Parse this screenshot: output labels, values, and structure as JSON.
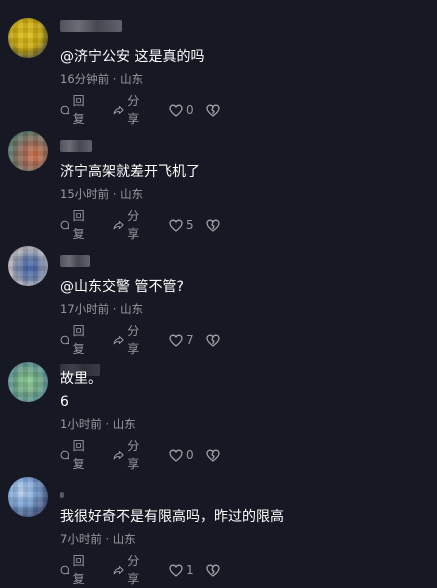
{
  "actions": {
    "reply_label": "回复",
    "share_label": "分享"
  },
  "comments": [
    {
      "text": "@济宁公安 这是真的吗",
      "extra": "",
      "time": "16分钟前",
      "location": "山东",
      "likes": "0"
    },
    {
      "text": "济宁高架就差开飞机了",
      "extra": "",
      "time": "15小时前",
      "location": "山东",
      "likes": "5"
    },
    {
      "text": "@山东交警 管不管?",
      "extra": "",
      "time": "17小时前",
      "location": "山东",
      "likes": "7"
    },
    {
      "text": "故里。",
      "extra": "6",
      "time": "1小时前",
      "location": "山东",
      "likes": "0"
    },
    {
      "text": "我很好奇不是有限高吗，昨过的限高",
      "extra": "",
      "time": "7小时前",
      "location": "山东",
      "likes": "1"
    }
  ]
}
